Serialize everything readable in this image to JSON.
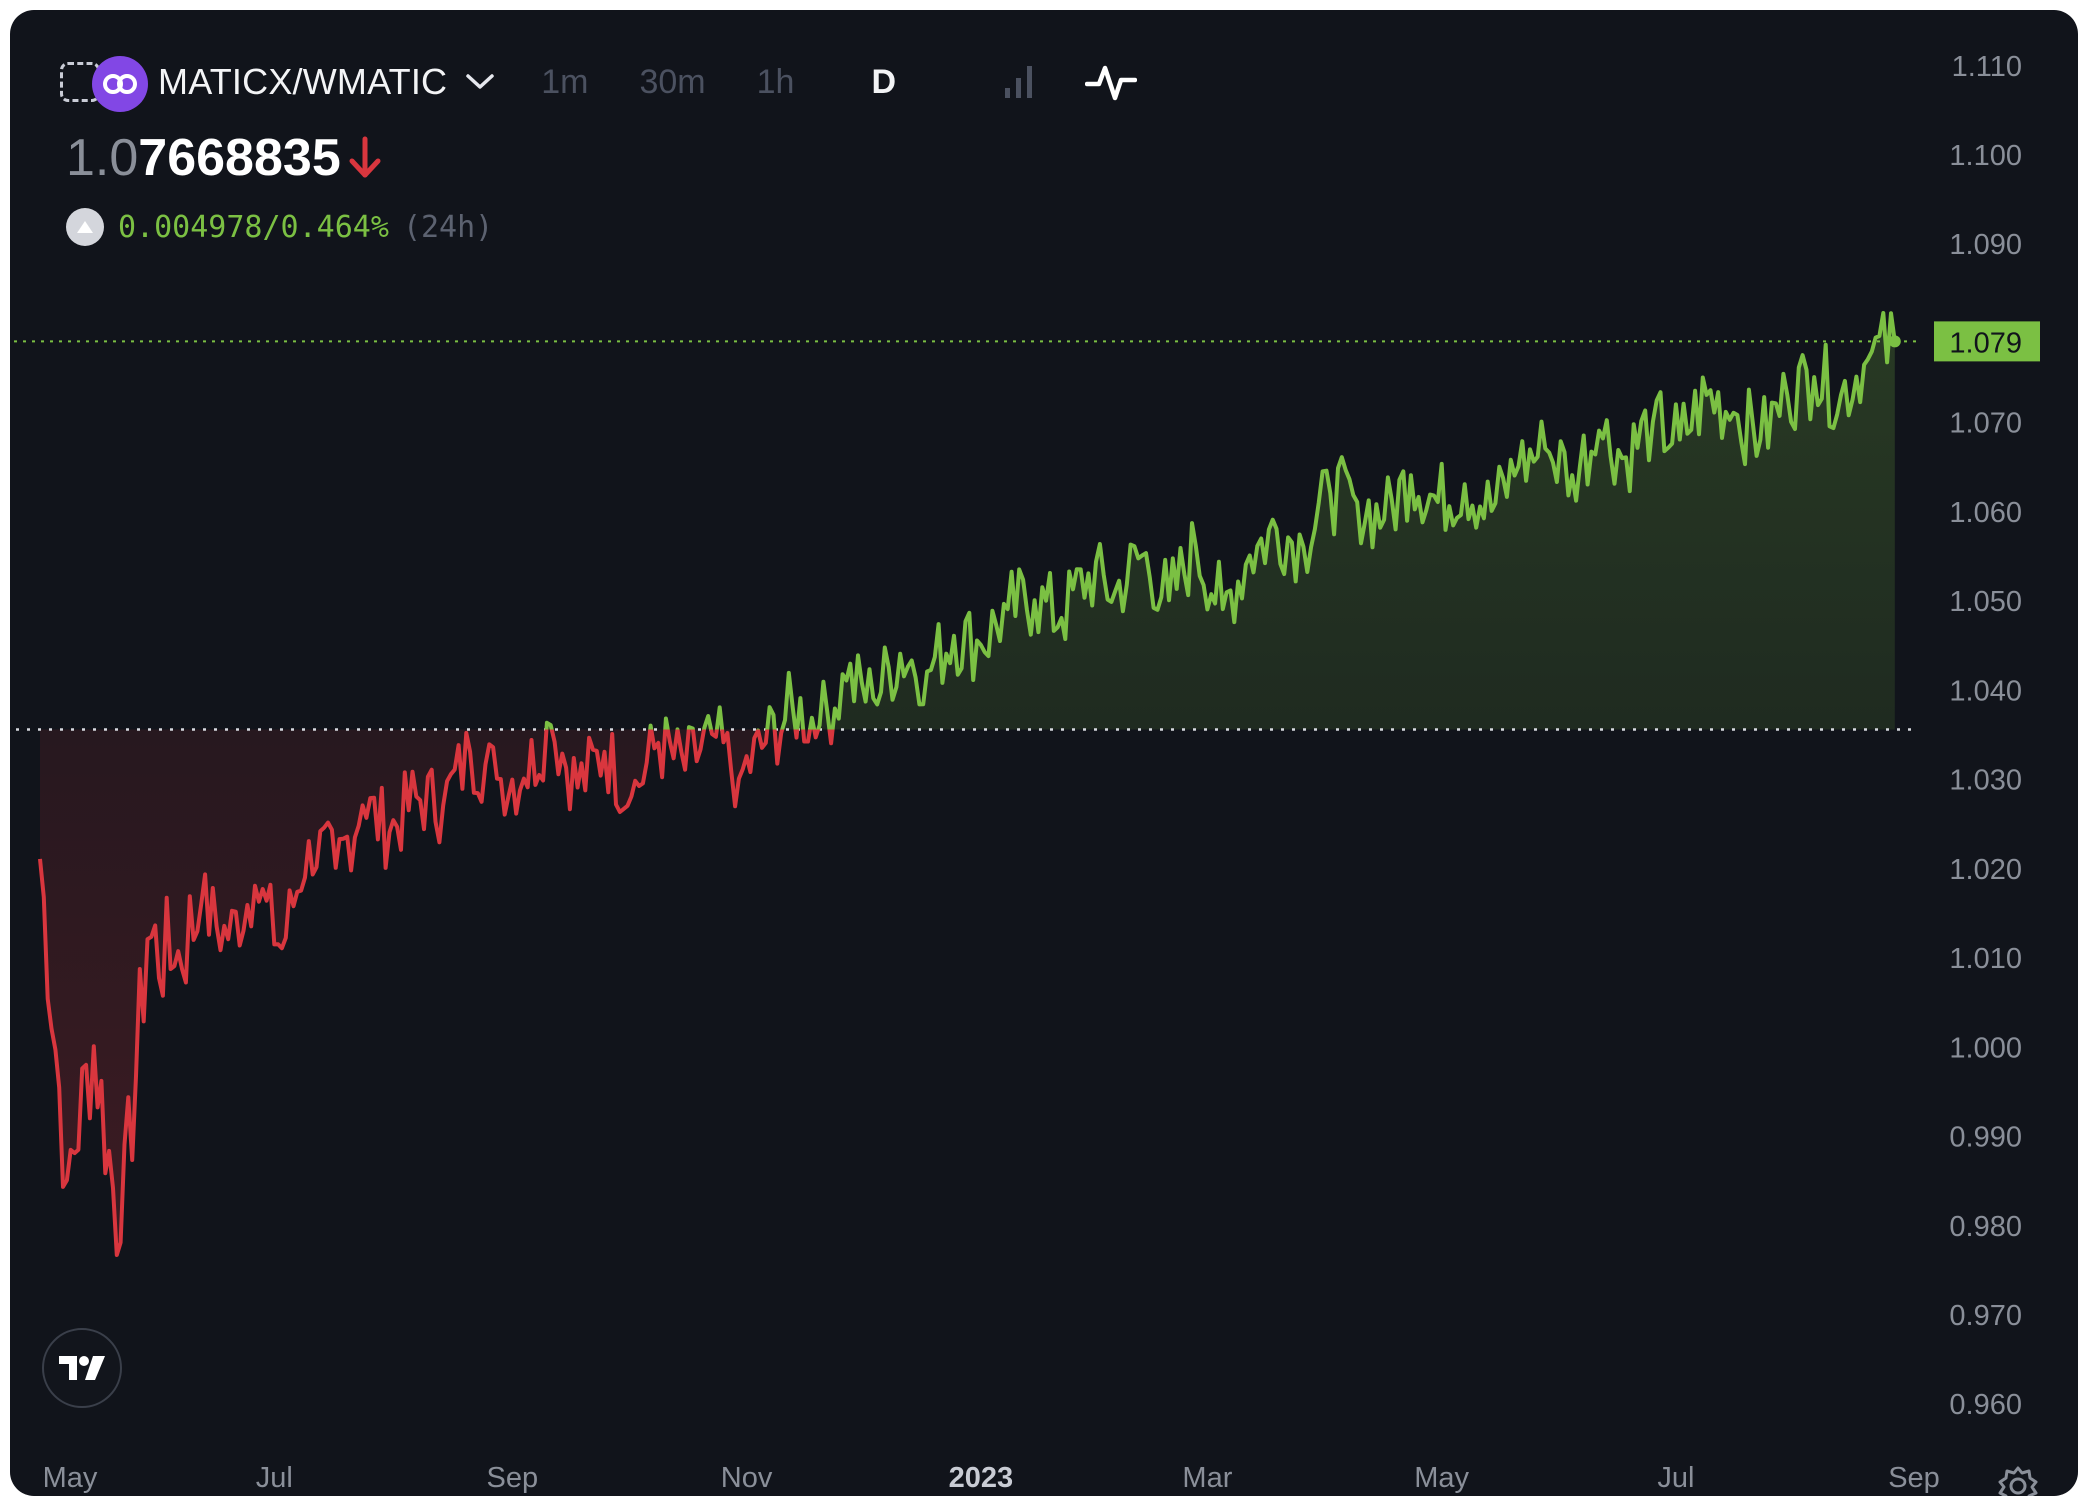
{
  "pair": {
    "name": "MATICX/WMATIC",
    "intervals": [
      "1m",
      "30m",
      "1h"
    ],
    "active_interval": "D"
  },
  "price": {
    "dim_part": "1.0",
    "main_part": "7668835",
    "direction": "down"
  },
  "change": {
    "value": "0.004978/0.464%",
    "period": "(24h)"
  },
  "colors": {
    "background": "#11141b",
    "up": "#7bc043",
    "down": "#d9363e",
    "axis_text": "#8a8f99"
  },
  "chart_data": {
    "type": "line",
    "title": "",
    "xlabel": "",
    "ylabel": "",
    "x_tick_labels": [
      "May",
      "Jul",
      "Sep",
      "Nov",
      "2023",
      "Mar",
      "May",
      "Jul",
      "Sep"
    ],
    "y_tick_labels": [
      "1.110",
      "1.100",
      "1.090",
      "1.079",
      "1.070",
      "1.060",
      "1.050",
      "1.040",
      "1.030",
      "1.020",
      "1.010",
      "1.000",
      "0.990",
      "0.980",
      "0.970",
      "0.960"
    ],
    "ylim": [
      0.957,
      1.113
    ],
    "xlim": [
      "2022-05-01",
      "2023-09-01"
    ],
    "baseline_value": 1.0355,
    "last_value": 1.079,
    "last_value_label": "1.079",
    "grid": false,
    "x": [
      "2022-05-01",
      "2022-05-08",
      "2022-05-15",
      "2022-05-22",
      "2022-05-29",
      "2022-06-05",
      "2022-06-12",
      "2022-06-19",
      "2022-06-26",
      "2022-07-03",
      "2022-07-10",
      "2022-07-17",
      "2022-07-24",
      "2022-07-31",
      "2022-08-07",
      "2022-08-14",
      "2022-08-21",
      "2022-08-28",
      "2022-09-04",
      "2022-09-11",
      "2022-09-18",
      "2022-09-25",
      "2022-10-02",
      "2022-10-09",
      "2022-10-16",
      "2022-10-23",
      "2022-10-30",
      "2022-11-06",
      "2022-11-13",
      "2022-11-20",
      "2022-11-27",
      "2022-12-04",
      "2022-12-11",
      "2022-12-18",
      "2022-12-25",
      "2023-01-01",
      "2023-01-08",
      "2023-01-15",
      "2023-01-22",
      "2023-01-29",
      "2023-02-05",
      "2023-02-12",
      "2023-02-19",
      "2023-02-26",
      "2023-03-05",
      "2023-03-12",
      "2023-03-19",
      "2023-03-26",
      "2023-04-02",
      "2023-04-09",
      "2023-04-16",
      "2023-04-23",
      "2023-04-30",
      "2023-05-07",
      "2023-05-14",
      "2023-05-21",
      "2023-05-28",
      "2023-06-04",
      "2023-06-11",
      "2023-06-18",
      "2023-06-25",
      "2023-07-02",
      "2023-07-09",
      "2023-07-16",
      "2023-07-23",
      "2023-07-30",
      "2023-08-06",
      "2023-08-13",
      "2023-08-20",
      "2023-08-27"
    ],
    "series": [
      {
        "values": [
          1.021,
          0.985,
          1.0,
          0.978,
          1.012,
          1.009,
          1.016,
          1.012,
          1.018,
          1.011,
          1.023,
          1.02,
          1.027,
          1.024,
          1.028,
          1.027,
          1.033,
          1.03,
          1.03,
          1.036,
          1.029,
          1.033,
          1.028,
          1.034,
          1.031,
          1.035,
          1.03,
          1.034,
          1.038,
          1.036,
          1.041,
          1.039,
          1.044,
          1.042,
          1.046,
          1.045,
          1.049,
          1.05,
          1.048,
          1.053,
          1.051,
          1.055,
          1.05,
          1.056,
          1.049,
          1.055,
          1.058,
          1.056,
          1.062,
          1.061,
          1.059,
          1.064,
          1.061,
          1.063,
          1.06,
          1.065,
          1.067,
          1.064,
          1.069,
          1.066,
          1.07,
          1.068,
          1.073,
          1.071,
          1.068,
          1.073,
          1.075,
          1.073,
          1.077,
          1.079
        ]
      }
    ]
  }
}
